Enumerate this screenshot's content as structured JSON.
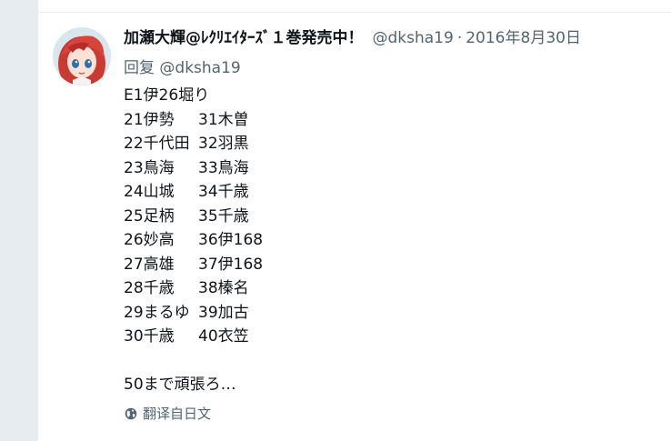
{
  "tweet": {
    "display_name": "加瀬大輝@ﾚｸﾘｴｲﾀｰｽﾞ１巻発売中！",
    "handle": "@dksha19",
    "separator": "·",
    "date": "2016年8月30日",
    "reply_label": "回复",
    "reply_mention": "@dksha19",
    "lines": [
      "E1伊26堀り",
      [
        "21伊勢",
        "31木曽"
      ],
      [
        "22千代田",
        "32羽黒"
      ],
      [
        "23鳥海",
        "33鳥海"
      ],
      [
        "24山城",
        "34千歳"
      ],
      [
        "25足柄",
        "35千歳"
      ],
      [
        "26妙高",
        "36伊168"
      ],
      [
        "27高雄",
        "37伊168"
      ],
      [
        "28千歳",
        "38榛名"
      ],
      [
        "29まるゆ",
        "39加古"
      ],
      [
        "30千歳",
        "40衣笠"
      ]
    ],
    "closing": "50まで頑張ろ…",
    "translate_label": "翻译自日文",
    "translate_icon": "globe-icon"
  },
  "colors": {
    "gutter": "#e6ecf0",
    "muted": "#536471",
    "text": "#0f1419"
  }
}
